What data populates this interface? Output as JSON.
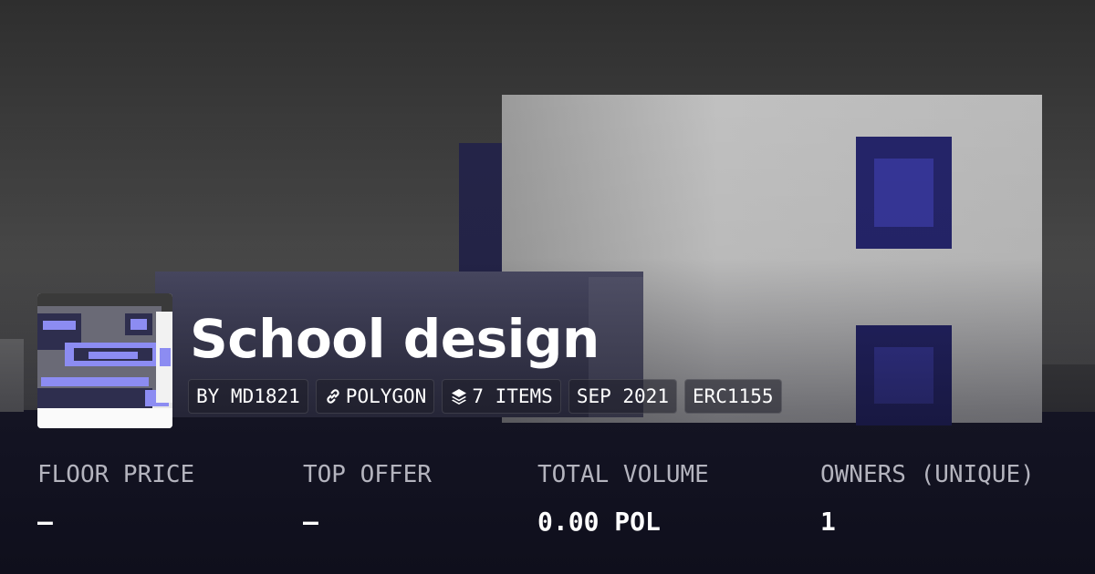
{
  "collection": {
    "title": "School design",
    "chips": {
      "creator": "BY MD1821",
      "chain": "POLYGON",
      "items": "7 ITEMS",
      "date": "SEP 2021",
      "standard": "ERC1155"
    },
    "chip_icons": {
      "chain": "link-icon",
      "items": "layers-icon"
    }
  },
  "stats": {
    "floor_price": {
      "label": "FLOOR PRICE",
      "value": "–"
    },
    "top_offer": {
      "label": "TOP OFFER",
      "value": "–"
    },
    "total_volume": {
      "label": "TOTAL VOLUME",
      "value": "0.00 POL"
    },
    "owners": {
      "label": "OWNERS (UNIQUE)",
      "value": "1"
    }
  },
  "colors": {
    "background_dark": "#1c1c30",
    "building_accent": "#25256b",
    "window_pane": "#37379a",
    "thumbnail_accent": "#8c8cf2",
    "label_gray": "#b4b4be",
    "text": "#ffffff"
  }
}
